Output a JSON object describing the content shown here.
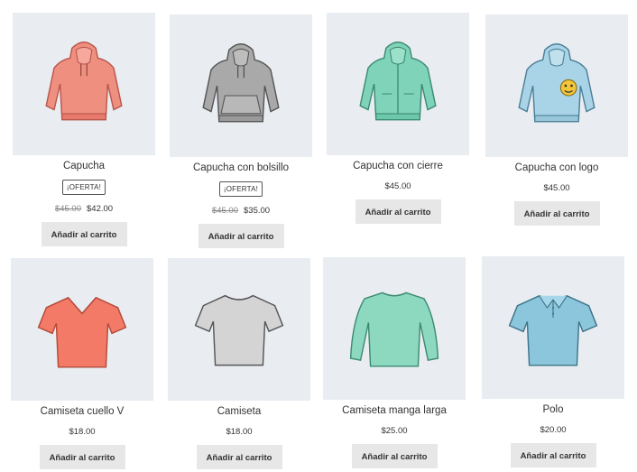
{
  "products": [
    {
      "title": "Capucha",
      "badge": "¡OFERTA!",
      "old_price": "$45.00",
      "price": "$42.00",
      "button": "Añadir al carrito",
      "icon": "hoodie-icon",
      "color": "#ef8f80"
    },
    {
      "title": "Capucha con bolsillo",
      "badge": "¡OFERTA!",
      "old_price": "$45.00",
      "price": "$35.00",
      "button": "Añadir al carrito",
      "icon": "hoodie-pocket-icon",
      "color": "#a9a9a9"
    },
    {
      "title": "Capucha con cierre",
      "price": "$45.00",
      "button": "Añadir al carrito",
      "icon": "zip-hoodie-icon",
      "color": "#7ed3b8"
    },
    {
      "title": "Capucha con logo",
      "price": "$45.00",
      "button": "Añadir al carrito",
      "icon": "hoodie-logo-icon",
      "color": "#a9d3e6"
    },
    {
      "title": "Camiseta cuello V",
      "price": "$18.00",
      "button": "Añadir al carrito",
      "icon": "vneck-tshirt-icon",
      "color": "#f27a66"
    },
    {
      "title": "Camiseta",
      "price": "$18.00",
      "button": "Añadir al carrito",
      "icon": "tshirt-icon",
      "color": "#d4d4d4"
    },
    {
      "title": "Camiseta manga larga",
      "price": "$25.00",
      "button": "Añadir al carrito",
      "icon": "longsleeve-icon",
      "color": "#8dd9bf"
    },
    {
      "title": "Polo",
      "price": "$20.00",
      "button": "Añadir al carrito",
      "icon": "polo-icon",
      "color": "#8cc6dc"
    }
  ]
}
